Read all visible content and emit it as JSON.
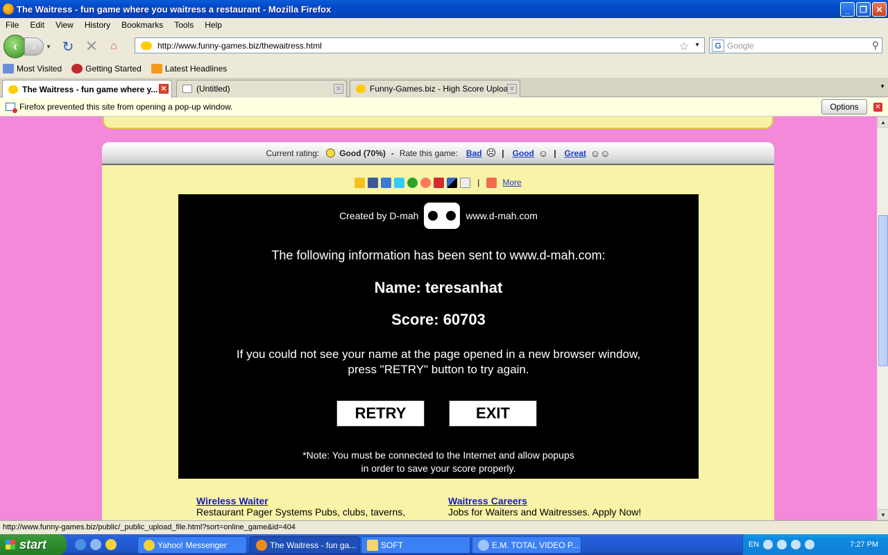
{
  "window": {
    "title": "The Waitress - fun game where you waitress a restaurant - Mozilla Firefox"
  },
  "menu": [
    "File",
    "Edit",
    "View",
    "History",
    "Bookmarks",
    "Tools",
    "Help"
  ],
  "nav": {
    "url": "http://www.funny-games.biz/thewaitress.html",
    "search_placeholder": "Google"
  },
  "bookmarks": [
    "Most Visited",
    "Getting Started",
    "Latest Headlines"
  ],
  "tabs": [
    {
      "label": "The Waitress - fun game where y..."
    },
    {
      "label": "(Untitled)"
    },
    {
      "label": "Funny-Games.biz - High Score Upload"
    }
  ],
  "popup_bar": {
    "message": "Firefox prevented this site from opening a pop-up window.",
    "options_label": "Options"
  },
  "rating": {
    "current_label": "Current rating:",
    "current_value": "Good (70%)",
    "sep": "-",
    "rate_label": "Rate this game:",
    "bad": "Bad",
    "good": "Good",
    "great": "Great"
  },
  "share": {
    "more": "More"
  },
  "game": {
    "credit_left": "Created by D-mah",
    "credit_right": "www.d-mah.com",
    "info": "The following information has been sent to www.d-mah.com:",
    "name": "Name: teresanhat",
    "score": "Score: 60703",
    "note_line1": "If you could not see your name at the page opened in a new browser window,",
    "note_line2": "press \"RETRY\" button to try again.",
    "retry": "RETRY",
    "exit": "EXIT",
    "footnote_line1": "*Note: You must be connected to the Internet and allow popups",
    "footnote_line2": "in order to save your score properly."
  },
  "ads": [
    {
      "title": "Wireless Waiter",
      "text": "Restaurant Pager Systems Pubs, clubs, taverns,"
    },
    {
      "title": "Waitress Careers",
      "text": "Jobs for Waiters and Waitresses. Apply Now!"
    }
  ],
  "status": {
    "text": "http://www.funny-games.biz/public/_public_upload_file.html?sort=online_game&id=404"
  },
  "taskbar": {
    "start": "start",
    "items": [
      "Yahoo! Messenger",
      "The Waitress - fun ga...",
      "SOFT",
      "E.M. TOTAL VIDEO P..."
    ],
    "lang": "EN",
    "clock": "7:27 PM"
  }
}
